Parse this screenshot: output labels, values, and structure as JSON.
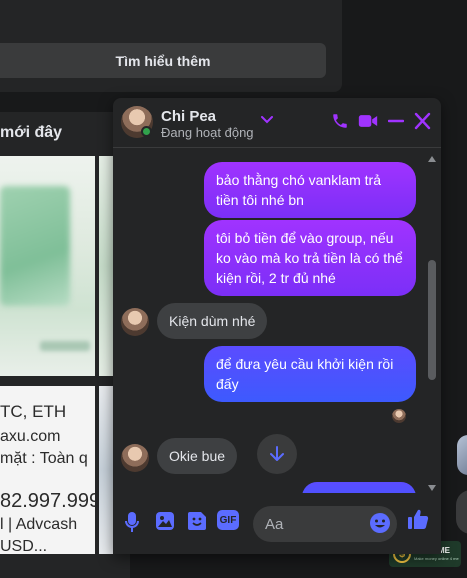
{
  "page": {
    "learn_more_label": "Tìm hiểu thêm",
    "recent_title": "mới đây",
    "thumb_text": [
      "TC, ETH",
      "axu.com",
      "mặt : Toàn q",
      "82.997.999",
      "l | Advcash",
      "USD..."
    ]
  },
  "chat": {
    "contact_name": "Chi Pea",
    "contact_status": "Đang hoạt động",
    "accent_color": "#a033ff",
    "header_icons": [
      "phone-icon",
      "video-icon",
      "minimize-icon",
      "close-icon"
    ],
    "messages": [
      {
        "dir": "out",
        "text": "bảo thằng chó vanklam trả tiền tôi nhé bn"
      },
      {
        "dir": "out",
        "text": "tôi bỏ tiền để vào group, nếu ko vào mà ko trả tiền là có thể kiện rồi, 2 tr đủ nhé"
      },
      {
        "dir": "in",
        "text": "Kiện dùm nhé"
      },
      {
        "dir": "out",
        "text": "để đưa yêu cầu khởi kiện rồi đấy"
      },
      {
        "dir": "in",
        "text": "Okie bue"
      }
    ],
    "composer": {
      "placeholder": "Aa",
      "icons": [
        "microphone-icon",
        "image-icon",
        "sticker-icon",
        "gif-icon",
        "emoji-icon",
        "like-icon"
      ],
      "gif_label": "GIF"
    }
  },
  "watermark": {
    "brand": "MMO4ME",
    "tagline": "Make money online 4 me"
  }
}
